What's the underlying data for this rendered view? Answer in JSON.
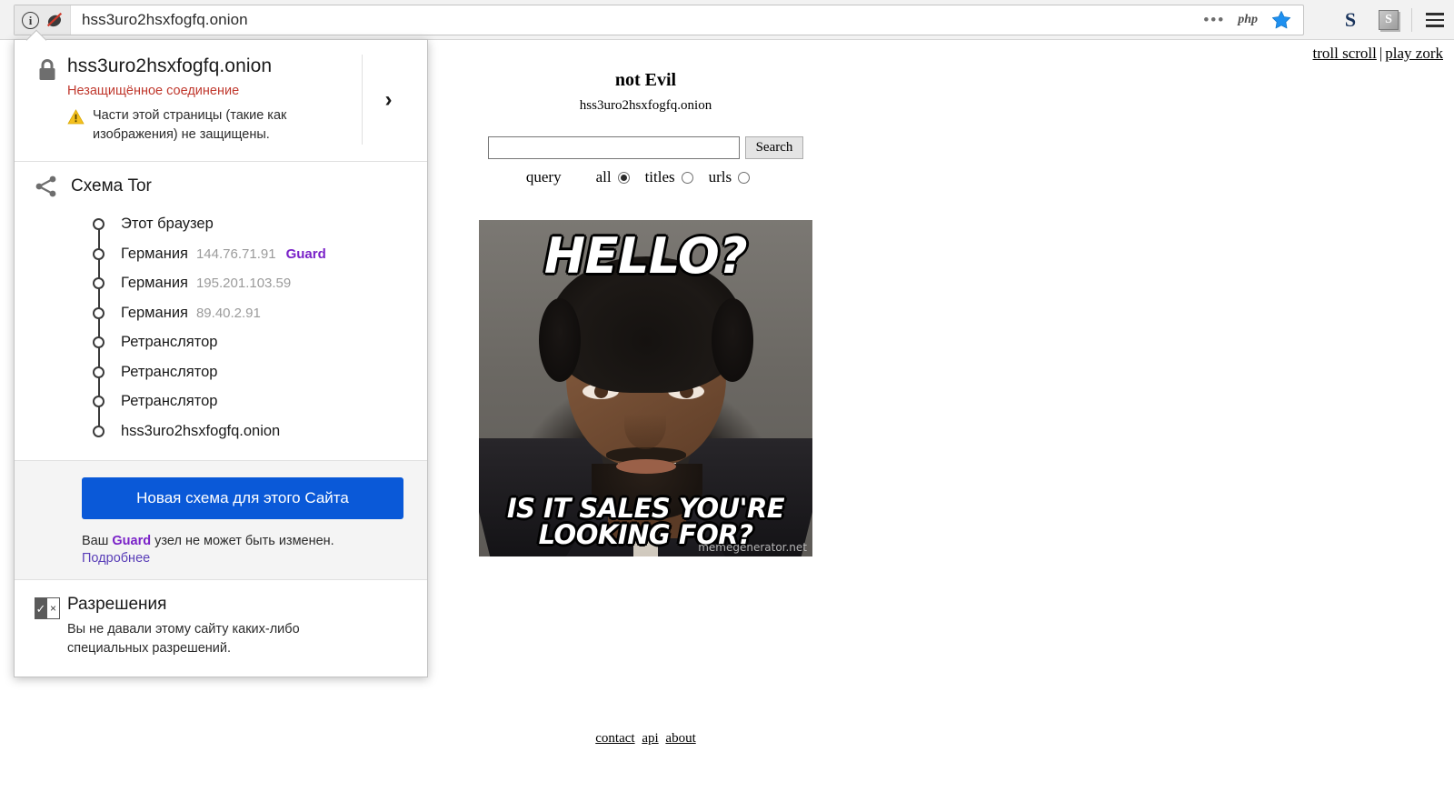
{
  "browser": {
    "url": "hss3uro2hsxfogfq.onion",
    "identity_icon": "info-circle-icon",
    "broken_lock_icon": "broken-shield-icon",
    "url_actions": {
      "more_dots": "•••",
      "php_badge": "php",
      "bookmark_star": "star-icon"
    },
    "toolbar_buttons": [
      {
        "name": "extension-s-bold",
        "label": "S"
      },
      {
        "name": "extension-s-box",
        "label": "S"
      }
    ],
    "menu_icon": "hamburger-menu-icon"
  },
  "identity_panel": {
    "security": {
      "host": "hss3uro2hsxfogfq.onion",
      "status": "Незащищённое соединение",
      "mixed_content_warning": "Части этой страницы (такие как изображения) не защищены.",
      "lock_icon": "lock-icon",
      "warning_icon": "warning-triangle-icon",
      "expand_icon": "chevron-right-icon"
    },
    "tor": {
      "title": "Схема Tor",
      "icon": "tor-circuit-icon",
      "nodes": [
        {
          "label": "Этот браузер",
          "ip": "",
          "tag": ""
        },
        {
          "label": "Германия",
          "ip": "144.76.71.91",
          "tag": "Guard"
        },
        {
          "label": "Германия",
          "ip": "195.201.103.59",
          "tag": ""
        },
        {
          "label": "Германия",
          "ip": "89.40.2.91",
          "tag": ""
        },
        {
          "label": "Ретранслятор",
          "ip": "",
          "tag": ""
        },
        {
          "label": "Ретранслятор",
          "ip": "",
          "tag": ""
        },
        {
          "label": "Ретранслятор",
          "ip": "",
          "tag": ""
        },
        {
          "label": "hss3uro2hsxfogfq.onion",
          "ip": "",
          "tag": ""
        }
      ],
      "new_circuit_button": "Новая схема для этого Сайта",
      "guard_note_prefix": "Ваш ",
      "guard_note_tag": "Guard",
      "guard_note_suffix": " узел не может быть изменен.",
      "more_link": "Подробнее"
    },
    "permissions": {
      "title": "Разрешения",
      "text": "Вы не давали этому сайту каких-либо специальных разрешений.",
      "icon": "permissions-checkbox-icon"
    },
    "accent_colors": {
      "insecure_red": "#c0392e",
      "guard_purple": "#7a22c8",
      "button_blue": "#0a59d8",
      "link_purple": "#5a3fb8"
    }
  },
  "page": {
    "top_links": [
      {
        "label": "troll scroll"
      },
      {
        "label": "play zork"
      }
    ],
    "top_links_separator": "|",
    "site_title": "not Evil",
    "site_host": "hss3uro2hsxfogfq.onion",
    "search": {
      "value": "",
      "placeholder": "",
      "button_label": "Search"
    },
    "query_label": "query",
    "query_options": [
      {
        "label": "all",
        "selected": true
      },
      {
        "label": "titles",
        "selected": false
      },
      {
        "label": "urls",
        "selected": false
      }
    ],
    "meme": {
      "top_text": "HELLO?",
      "bottom_text": "IS IT SALES YOU'RE LOOKING FOR?",
      "watermark": "memegenerator.net"
    },
    "footer_links": [
      {
        "label": "contact"
      },
      {
        "label": "api"
      },
      {
        "label": "about"
      }
    ]
  }
}
